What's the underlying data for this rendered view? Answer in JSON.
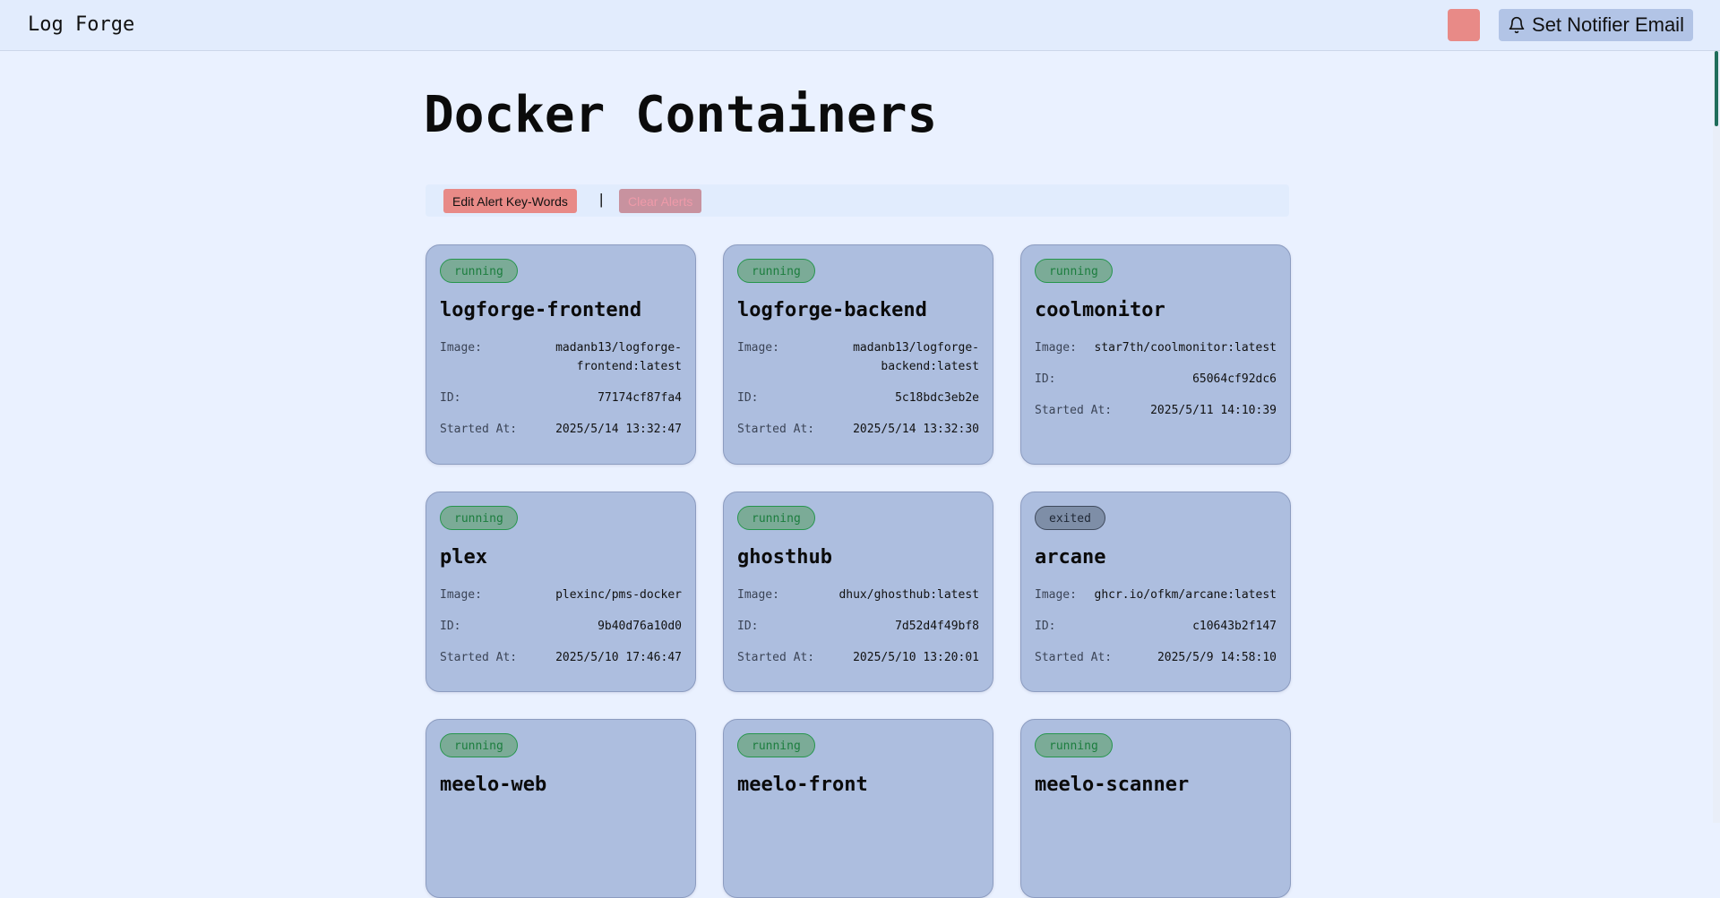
{
  "header": {
    "brand": "Log Forge",
    "notifier_label": "Set Notifier Email",
    "theme_color": "#e88a87"
  },
  "page": {
    "title": "Docker Containers"
  },
  "toolbar": {
    "edit_alert_label": "Edit Alert Key-Words",
    "separator": "|",
    "clear_alerts_label": "Clear Alerts"
  },
  "labels": {
    "image": "Image:",
    "id": "ID:",
    "started_at": "Started At:"
  },
  "colors": {
    "background": "#eaf1ff",
    "card": "#adbedf",
    "running": "#1c7d3e",
    "exited": "#1f2734",
    "accent_red": "#e88a87"
  },
  "containers": [
    {
      "status": "running",
      "name": "logforge-frontend",
      "image": "madanb13/logforge-frontend:latest",
      "id": "77174cf87fa4",
      "started_at": "2025/5/14 13:32:47"
    },
    {
      "status": "running",
      "name": "logforge-backend",
      "image": "madanb13/logforge-backend:latest",
      "id": "5c18bdc3eb2e",
      "started_at": "2025/5/14 13:32:30"
    },
    {
      "status": "running",
      "name": "coolmonitor",
      "image": "star7th/coolmonitor:latest",
      "id": "65064cf92dc6",
      "started_at": "2025/5/11 14:10:39"
    },
    {
      "status": "running",
      "name": "plex",
      "image": "plexinc/pms-docker",
      "id": "9b40d76a10d0",
      "started_at": "2025/5/10 17:46:47"
    },
    {
      "status": "running",
      "name": "ghosthub",
      "image": "dhux/ghosthub:latest",
      "id": "7d52d4f49bf8",
      "started_at": "2025/5/10 13:20:01"
    },
    {
      "status": "exited",
      "name": "arcane",
      "image": "ghcr.io/ofkm/arcane:latest",
      "id": "c10643b2f147",
      "started_at": "2025/5/9 14:58:10"
    },
    {
      "status": "running",
      "name": "meelo-web"
    },
    {
      "status": "running",
      "name": "meelo-front"
    },
    {
      "status": "running",
      "name": "meelo-scanner"
    }
  ]
}
